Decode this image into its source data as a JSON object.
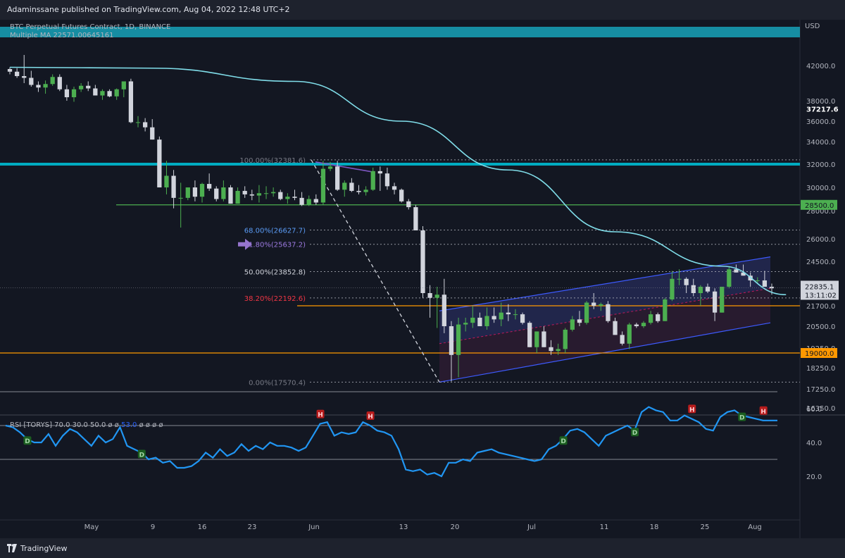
{
  "header": {
    "publisher_text": "Adaminssane published on TradingView.com, Aug 04, 2022 12:48 UTC+2"
  },
  "legend": {
    "symbol": "BTC Perpetual Futures Contract, 1D, BINANCE",
    "indicator": "Multiple MA  22571.00645161"
  },
  "rsi_legend": {
    "label": "RSI [TORYS]",
    "params": "70.0  30.0  50.0  ø  ø",
    "value": "53.0",
    "tail": "ø  ø  ø  ø"
  },
  "footer": {
    "brand": "TradingView"
  },
  "chart_data": {
    "type": "candlestick",
    "title": "BTC Perpetual Futures Contract, 1D, BINANCE",
    "price_axis_label": "USD",
    "y_ticks": [
      42000.0,
      38000.0,
      36000.0,
      34000.0,
      32000.0,
      30000.0,
      28000.0,
      26000.0,
      24500.0,
      21700.0,
      20500.0,
      19250.0,
      18250.0,
      17250.0,
      16350.0
    ],
    "x_ticks": [
      "May",
      "9",
      "16",
      "23",
      "Jun",
      "13",
      "20",
      "Jul",
      "11",
      "18",
      "25",
      "Aug"
    ],
    "candles": [
      [
        41600,
        41800,
        41000,
        41300
      ],
      [
        41300,
        41700,
        40600,
        40800
      ],
      [
        40800,
        43200,
        40000,
        40600
      ],
      [
        40600,
        41400,
        39600,
        39800
      ],
      [
        39800,
        40200,
        39000,
        39500
      ],
      [
        39500,
        40300,
        38800,
        39900
      ],
      [
        39900,
        41000,
        39700,
        40700
      ],
      [
        40700,
        41000,
        39100,
        39300
      ],
      [
        39300,
        39800,
        38000,
        38400
      ],
      [
        38400,
        39600,
        37900,
        39300
      ],
      [
        39300,
        40000,
        39000,
        39700
      ],
      [
        39700,
        40200,
        39100,
        39400
      ],
      [
        39400,
        39800,
        38600,
        38600
      ],
      [
        38600,
        39300,
        38100,
        39100
      ],
      [
        39100,
        39300,
        38400,
        38500
      ],
      [
        38500,
        39400,
        38100,
        39300
      ],
      [
        39300,
        40200,
        38400,
        40200
      ],
      [
        40200,
        40500,
        35800,
        35900
      ],
      [
        35900,
        36500,
        35400,
        35900
      ],
      [
        35900,
        36300,
        35000,
        35400
      ],
      [
        35400,
        36200,
        34200,
        34200
      ],
      [
        34200,
        34500,
        30000,
        30000
      ],
      [
        30000,
        32300,
        29400,
        31000
      ],
      [
        31000,
        31500,
        28200,
        29100
      ],
      [
        29100,
        30400,
        26800,
        29100
      ],
      [
        29100,
        30000,
        28900,
        30000
      ],
      [
        30000,
        30600,
        28800,
        29200
      ],
      [
        29200,
        30400,
        28700,
        30300
      ],
      [
        30300,
        31200,
        29700,
        29900
      ],
      [
        29900,
        30100,
        28800,
        29000
      ],
      [
        29000,
        30600,
        28800,
        30000
      ],
      [
        30000,
        30200,
        28600,
        28600
      ],
      [
        28600,
        30000,
        28600,
        29700
      ],
      [
        29700,
        30100,
        29100,
        29400
      ],
      [
        29400,
        29800,
        28900,
        29300
      ],
      [
        29300,
        30200,
        28700,
        29500
      ],
      [
        29500,
        30100,
        29000,
        29500
      ],
      [
        29500,
        30000,
        29200,
        29600
      ],
      [
        29600,
        29800,
        28900,
        29000
      ],
      [
        29000,
        29500,
        28600,
        29200
      ],
      [
        29200,
        29800,
        28900,
        29100
      ],
      [
        29100,
        29600,
        28400,
        28500
      ],
      [
        28500,
        29300,
        28400,
        29000
      ],
      [
        29000,
        29400,
        28500,
        28700
      ],
      [
        28700,
        32300,
        28500,
        31600
      ],
      [
        31600,
        32200,
        31400,
        31800
      ],
      [
        31800,
        32300,
        29700,
        29800
      ],
      [
        29800,
        30600,
        29200,
        30400
      ],
      [
        30400,
        30800,
        29600,
        29700
      ],
      [
        29700,
        30200,
        29400,
        29600
      ],
      [
        29600,
        30100,
        29300,
        29800
      ],
      [
        29800,
        31700,
        29700,
        31400
      ],
      [
        31400,
        31800,
        29700,
        31200
      ],
      [
        31200,
        31700,
        29800,
        30100
      ],
      [
        30100,
        30400,
        29400,
        29800
      ],
      [
        29800,
        29900,
        28700,
        28800
      ],
      [
        28800,
        29000,
        28100,
        28300
      ],
      [
        28300,
        28500,
        26600,
        26600
      ],
      [
        26600,
        26900,
        22200,
        22500
      ],
      [
        22500,
        23000,
        21000,
        22200
      ],
      [
        22200,
        22900,
        20400,
        22400
      ],
      [
        22400,
        23400,
        20100,
        20500
      ],
      [
        20500,
        20800,
        17600,
        18900
      ],
      [
        18900,
        21000,
        17800,
        20600
      ],
      [
        20600,
        21000,
        20200,
        20700
      ],
      [
        20700,
        21700,
        20400,
        21000
      ],
      [
        21000,
        21300,
        20500,
        20500
      ],
      [
        20500,
        21600,
        20300,
        21100
      ],
      [
        21100,
        21600,
        20700,
        20900
      ],
      [
        20900,
        21900,
        20500,
        21300
      ],
      [
        21300,
        21800,
        20800,
        21200
      ],
      [
        21200,
        21500,
        20900,
        21200
      ],
      [
        21200,
        21300,
        20600,
        20700
      ],
      [
        20700,
        20800,
        19300,
        19300
      ],
      [
        19300,
        20200,
        19000,
        20200
      ],
      [
        20200,
        20500,
        19300,
        19300
      ],
      [
        19300,
        19700,
        18900,
        19100
      ],
      [
        19100,
        19500,
        18900,
        19200
      ],
      [
        19200,
        20400,
        19000,
        20300
      ],
      [
        20300,
        21100,
        20200,
        20900
      ],
      [
        20900,
        21400,
        20500,
        20700
      ],
      [
        20700,
        22000,
        20600,
        21900
      ],
      [
        21900,
        22500,
        21500,
        21700
      ],
      [
        21700,
        21900,
        21400,
        21800
      ],
      [
        21800,
        22000,
        20700,
        20800
      ],
      [
        20800,
        21000,
        20000,
        20000
      ],
      [
        20000,
        20200,
        19400,
        19500
      ],
      [
        19500,
        20700,
        19200,
        20600
      ],
      [
        20600,
        20700,
        20400,
        20500
      ],
      [
        20500,
        20800,
        20400,
        20700
      ],
      [
        20700,
        21400,
        20600,
        21200
      ],
      [
        21200,
        21300,
        20700,
        20800
      ],
      [
        20800,
        22200,
        20800,
        22100
      ],
      [
        22100,
        23900,
        22000,
        23400
      ],
      [
        23400,
        24000,
        23000,
        23400
      ],
      [
        23400,
        23500,
        22500,
        23000
      ],
      [
        23000,
        23400,
        22300,
        22500
      ],
      [
        22500,
        23000,
        21700,
        22900
      ],
      [
        22900,
        23100,
        22500,
        22600
      ],
      [
        22600,
        22800,
        20800,
        21300
      ],
      [
        21300,
        22800,
        21300,
        22900
      ],
      [
        22900,
        24200,
        22800,
        24000
      ],
      [
        24000,
        24300,
        23800,
        23800
      ],
      [
        23800,
        24300,
        23600,
        23600
      ],
      [
        23600,
        23800,
        22900,
        23300
      ],
      [
        23300,
        23500,
        23100,
        23300
      ],
      [
        23300,
        23900,
        22900,
        22900
      ],
      [
        22900,
        23100,
        22400,
        22800
      ]
    ],
    "moving_average": {
      "name": "Multiple MA",
      "last": 22571.0,
      "points": [
        [
          0,
          41800
        ],
        [
          20,
          41700
        ],
        [
          40,
          40200
        ],
        [
          55,
          36000
        ],
        [
          70,
          31500
        ],
        [
          85,
          26500
        ],
        [
          100,
          24200
        ],
        [
          109,
          22400
        ]
      ]
    },
    "fibonacci": [
      {
        "level": "100.00%",
        "price": 32381.6
      },
      {
        "level": "68.00%",
        "price": 26627.7
      },
      {
        "level": "61.80%",
        "price": 25637.2
      },
      {
        "level": "50.00%",
        "price": 23852.8
      },
      {
        "level": "38.20%",
        "price": 22192.6
      },
      {
        "level": "0.00%",
        "price": 17570.4
      }
    ],
    "horizontal_levels": [
      {
        "price": 32000,
        "color": "#00acc1"
      },
      {
        "price": 28500.0,
        "color": "#4caf50",
        "label": "28500.0"
      },
      {
        "price": 21700,
        "color": "#ff9800"
      },
      {
        "price": 19000.0,
        "color": "#ff9800",
        "label": "19000.0"
      }
    ],
    "price_labels": [
      {
        "text": "37217.6",
        "price": 37217.6
      },
      {
        "text": "22835.1",
        "price": 22835.1,
        "sub": "13:11:02"
      }
    ],
    "rsi": {
      "levels": [
        70,
        50,
        30
      ],
      "y_ticks": [
        60.0,
        40.0,
        20.0
      ],
      "last": 53.0,
      "values": [
        50,
        49,
        46,
        42,
        40,
        40,
        45,
        38,
        44,
        48,
        46,
        42,
        38,
        44,
        40,
        42,
        49,
        38,
        36,
        34,
        30,
        31,
        28,
        29,
        25,
        25,
        26,
        29,
        34,
        31,
        36,
        32,
        34,
        39,
        35,
        38,
        36,
        40,
        38,
        38,
        37,
        35,
        37,
        44,
        51,
        52,
        44,
        46,
        45,
        46,
        52,
        50,
        47,
        46,
        44,
        36,
        24,
        23,
        24,
        21,
        22,
        20,
        28,
        28,
        30,
        29,
        34,
        35,
        36,
        34,
        33,
        32,
        31,
        30,
        29,
        30,
        36,
        38,
        42,
        47,
        48,
        46,
        42,
        38,
        44,
        46,
        48,
        50,
        47,
        58,
        61,
        59,
        58,
        53,
        53,
        56,
        54,
        52,
        48,
        47,
        55,
        58,
        59,
        56,
        55,
        54,
        53,
        53,
        53
      ]
    },
    "rsi_markers": [
      {
        "type": "D",
        "index": 5
      },
      {
        "type": "D",
        "index": 27
      },
      {
        "type": "H",
        "index": 63
      },
      {
        "type": "H",
        "index": 73
      },
      {
        "type": "D",
        "index": 112
      },
      {
        "type": "D",
        "index": 127
      },
      {
        "type": "H",
        "index": 138
      },
      {
        "type": "D",
        "index": 148
      },
      {
        "type": "H",
        "index": 152
      }
    ]
  }
}
